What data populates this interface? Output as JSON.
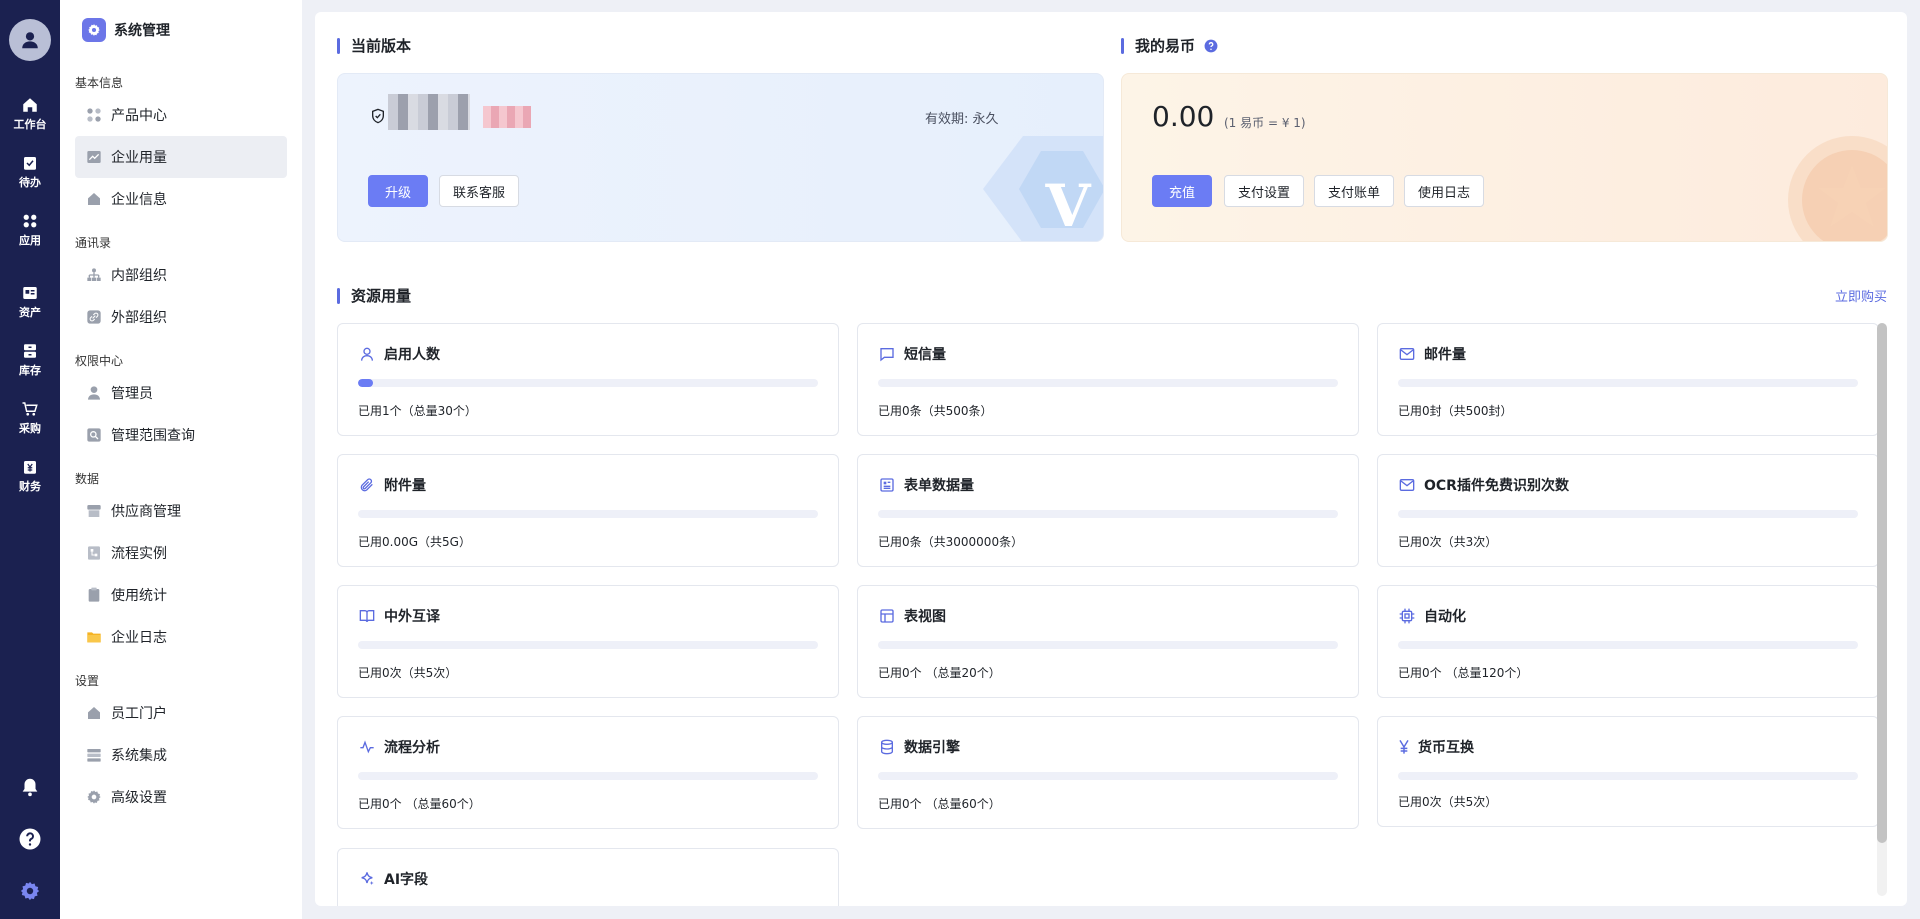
{
  "rail": {
    "items": [
      {
        "label": "工作台",
        "icon": "home-icon"
      },
      {
        "label": "待办",
        "icon": "todo-icon"
      },
      {
        "label": "应用",
        "icon": "apps-icon"
      },
      {
        "label": "资产",
        "icon": "assets-icon"
      },
      {
        "label": "库存",
        "icon": "inventory-icon"
      },
      {
        "label": "采购",
        "icon": "cart-icon"
      },
      {
        "label": "财务",
        "icon": "finance-icon"
      }
    ]
  },
  "sidebar": {
    "title": "系统管理",
    "groups": [
      {
        "title": "基本信息",
        "items": [
          {
            "label": "产品中心"
          },
          {
            "label": "企业用量"
          },
          {
            "label": "企业信息"
          }
        ]
      },
      {
        "title": "通讯录",
        "items": [
          {
            "label": "内部组织"
          },
          {
            "label": "外部组织"
          }
        ]
      },
      {
        "title": "权限中心",
        "items": [
          {
            "label": "管理员"
          },
          {
            "label": "管理范围查询"
          }
        ]
      },
      {
        "title": "数据",
        "items": [
          {
            "label": "供应商管理"
          },
          {
            "label": "流程实例"
          },
          {
            "label": "使用统计"
          },
          {
            "label": "企业日志"
          }
        ]
      },
      {
        "title": "设置",
        "items": [
          {
            "label": "员工门户"
          },
          {
            "label": "系统集成"
          },
          {
            "label": "高级设置"
          }
        ]
      }
    ]
  },
  "version": {
    "section_title": "当前版本",
    "validity": "有效期: 永久",
    "upgrade_label": "升级",
    "contact_label": "联系客服",
    "watermark": "V"
  },
  "coins": {
    "section_title": "我的易币",
    "balance": "0.00",
    "rate": "(1 易币 = ¥ 1)",
    "buttons": [
      "充值",
      "支付设置",
      "支付账单",
      "使用日志"
    ]
  },
  "resources": {
    "section_title": "资源用量",
    "buy_label": "立即购买",
    "items": [
      {
        "name": "启用人数",
        "icon": "user-icon",
        "usage": "已用1个（总量30个）",
        "percent": 3.3
      },
      {
        "name": "短信量",
        "icon": "message-icon",
        "usage": "已用0条（共500条）",
        "percent": 0
      },
      {
        "name": "邮件量",
        "icon": "mail-icon",
        "usage": "已用0封（共500封）",
        "percent": 0
      },
      {
        "name": "附件量",
        "icon": "paperclip-icon",
        "usage": "已用0.00G（共5G）",
        "percent": 0
      },
      {
        "name": "表单数据量",
        "icon": "form-icon",
        "usage": "已用0条（共3000000条）",
        "percent": 0
      },
      {
        "name": "OCR插件免费识别次数",
        "icon": "mail-icon",
        "usage": "已用0次（共3次）",
        "percent": 0
      },
      {
        "name": "中外互译",
        "icon": "book-icon",
        "usage": "已用0次（共5次）",
        "percent": 0
      },
      {
        "name": "表视图",
        "icon": "table-icon",
        "usage": "已用0个 （总量20个）",
        "percent": 0
      },
      {
        "name": "自动化",
        "icon": "chip-icon",
        "usage": "已用0个 （总量120个）",
        "percent": 0
      },
      {
        "name": "流程分析",
        "icon": "pulse-icon",
        "usage": "已用0个 （总量60个）",
        "percent": 0
      },
      {
        "name": "数据引擎",
        "icon": "database-icon",
        "usage": "已用0个 （总量60个）",
        "percent": 0
      },
      {
        "name": "货币互换",
        "icon": "yen-icon",
        "usage": "已用0次（共5次）",
        "percent": 0
      },
      {
        "name": "AI字段",
        "icon": "sparkle-icon",
        "usage": "",
        "percent": 0
      }
    ]
  },
  "colors": {
    "accent": "#6b7cf4",
    "rail": "#1b2150"
  }
}
